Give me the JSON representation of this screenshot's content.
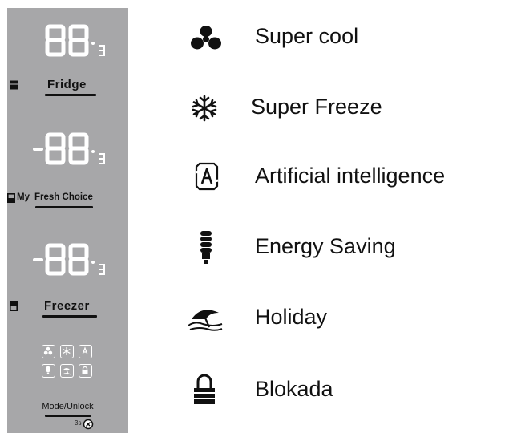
{
  "panel": {
    "displays": [
      {
        "digits": "88",
        "unit": "c",
        "minus": false
      },
      {
        "digits": "88",
        "unit": "c",
        "minus": true
      },
      {
        "digits": "88",
        "unit": "c",
        "minus": true
      }
    ],
    "zones": [
      {
        "label": "Fridge"
      },
      {
        "prefix": "My ",
        "label": "Fresh Choice"
      },
      {
        "label": "Freezer"
      }
    ],
    "mode_label": "Mode/Unlock",
    "mode_number": "3s"
  },
  "legend": [
    {
      "icon": "fan-icon",
      "label": "Super cool"
    },
    {
      "icon": "snowflake-icon",
      "label": "Super Freeze"
    },
    {
      "icon": "ai-icon",
      "label": "Artificial intelligence"
    },
    {
      "icon": "energy-bulb-icon",
      "label": "Energy Saving"
    },
    {
      "icon": "holiday-umbrella-icon",
      "label": "Holiday"
    },
    {
      "icon": "lock-icon",
      "label": "Blokada"
    }
  ],
  "colors": {
    "panel": "#a7a7a9",
    "segment": "#ffffff",
    "text": "#111111"
  }
}
